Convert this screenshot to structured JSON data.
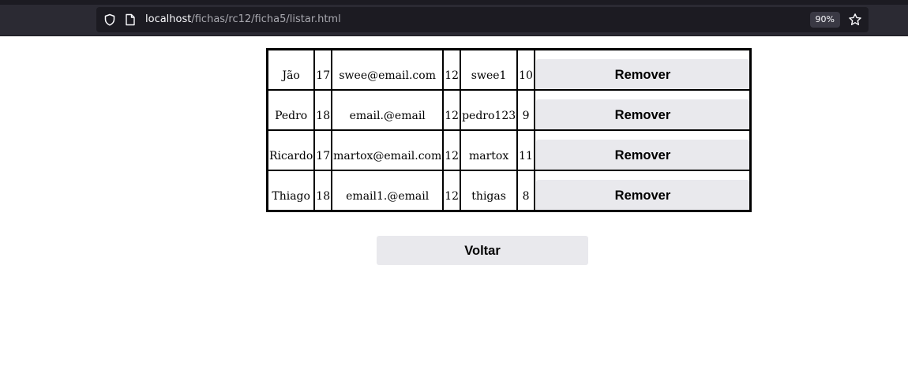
{
  "browser": {
    "url_host": "localhost",
    "url_path": "/fichas/rc12/ficha5/listar.html",
    "zoom": "90%",
    "icons": [
      "shield-icon",
      "page-icon",
      "star-icon"
    ]
  },
  "table": {
    "rows": [
      {
        "name": "Jão",
        "age": "17",
        "email": "swee@email.com",
        "class": "12",
        "username": "swee1",
        "number": "10",
        "action": "Remover"
      },
      {
        "name": "Pedro",
        "age": "18",
        "email": "email.@email",
        "class": "12",
        "username": "pedro123",
        "number": "9",
        "action": "Remover"
      },
      {
        "name": "Ricardo",
        "age": "17",
        "email": "martox@email.com",
        "class": "12",
        "username": "martox",
        "number": "11",
        "action": "Remover"
      },
      {
        "name": "Thiago",
        "age": "18",
        "email": "email1.@email",
        "class": "12",
        "username": "thigas",
        "number": "8",
        "action": "Remover"
      }
    ]
  },
  "back_label": "Voltar"
}
